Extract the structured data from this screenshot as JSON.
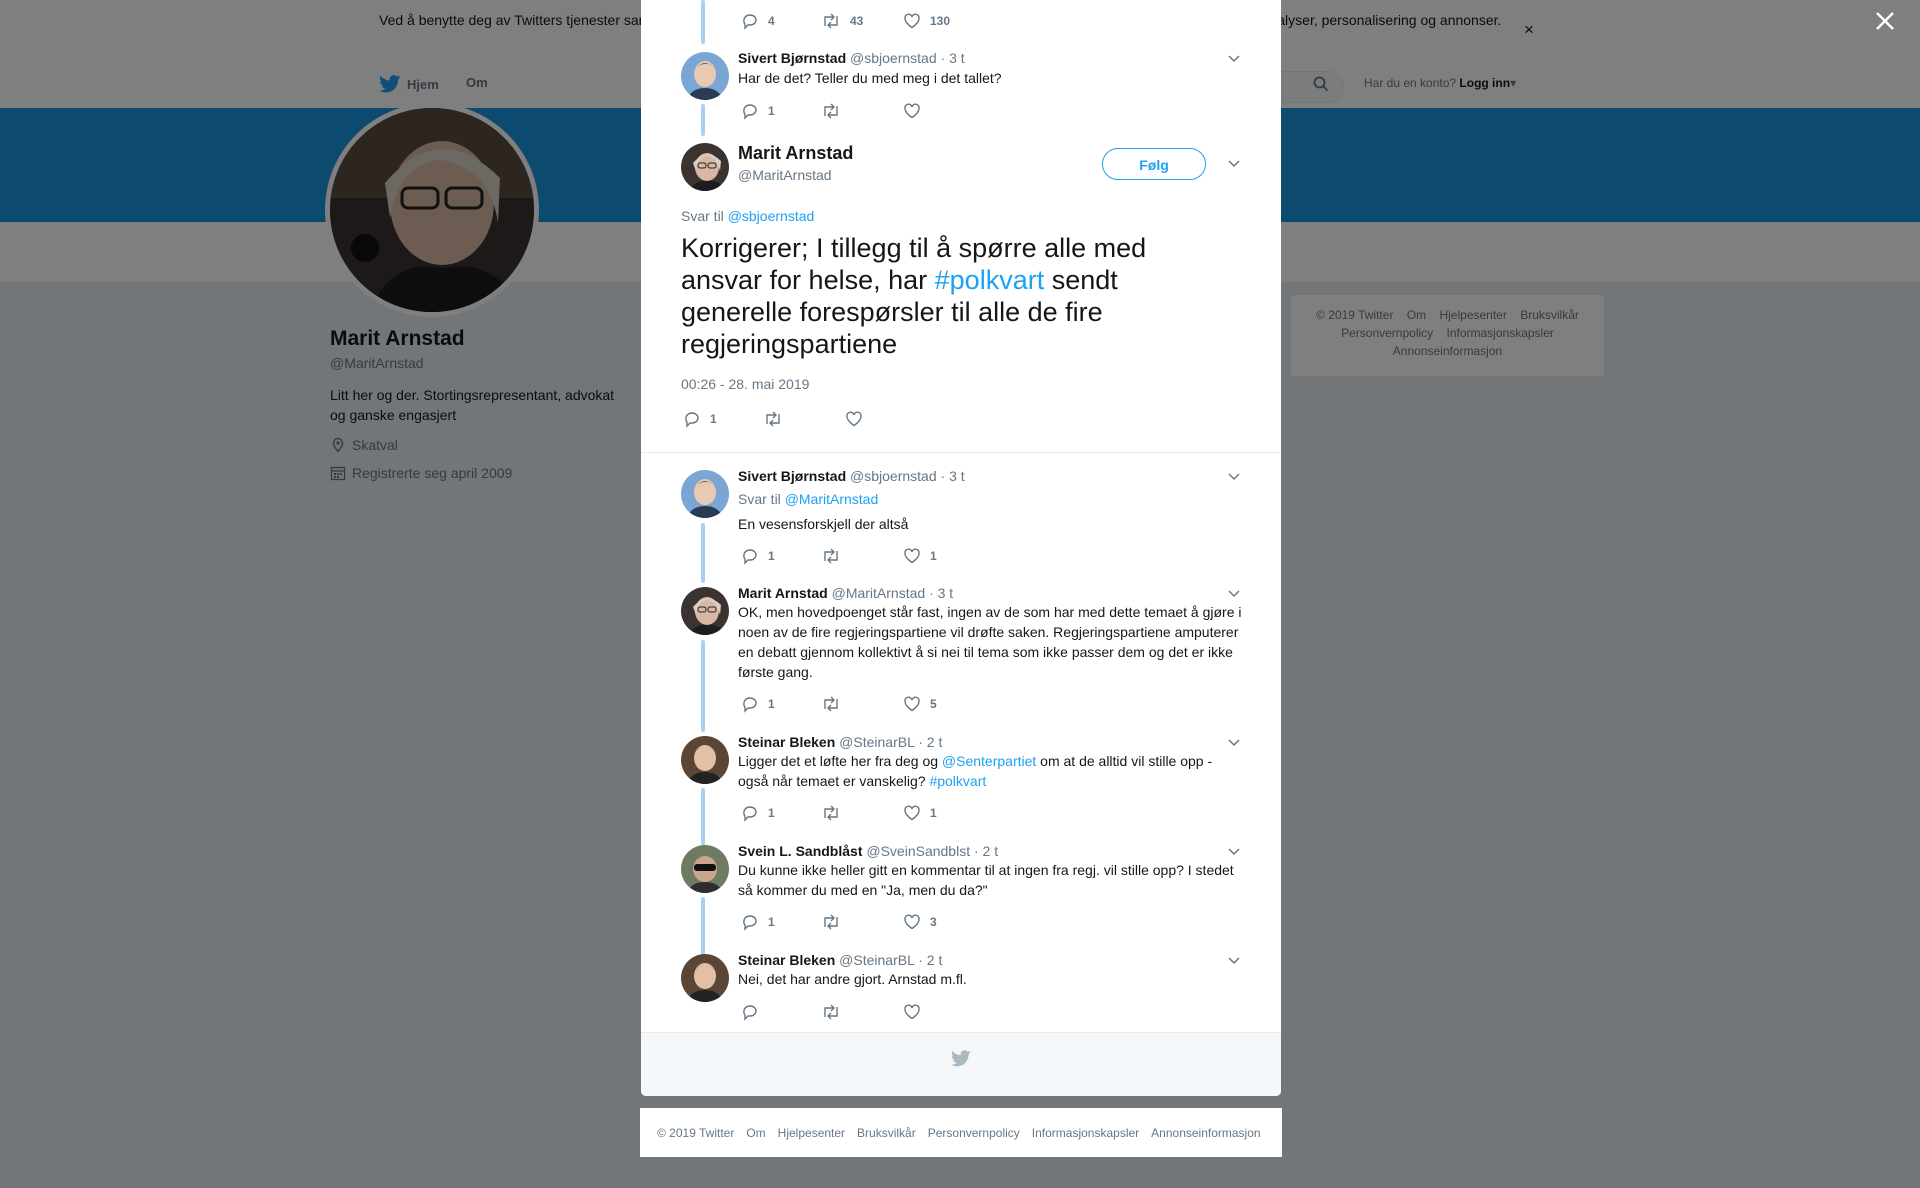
{
  "cookie": {
    "text": "Ved å benytte deg av Twitters tjenester samtykker du i vår bruk av informasjonskapsler. Vi og våre partnere bruker informasjonskapsler til bl.a. analyser, personalisering og annonser."
  },
  "nav": {
    "home": "Hjem",
    "about": "Om",
    "login_prompt": "Har du en konto?",
    "login_link": "Logg inn"
  },
  "profile": {
    "name": "Marit Arnstad",
    "handle": "@MaritArnstad",
    "bio": "Litt her og der. Stortingsrepresentant, advokat og ganske engasjert",
    "location": "Skatval",
    "joined": "Registrerte seg april 2009"
  },
  "side_footer": {
    "line1": [
      "© 2019 Twitter",
      "Om",
      "Hjelpesenter",
      "Bruksvilkår"
    ],
    "line2": [
      "Personvernpolicy",
      "Informasjonskapsler"
    ],
    "line3": [
      "Annonseinformasjon"
    ]
  },
  "top_stats": {
    "replies": "4",
    "retweets": "43",
    "likes": "130"
  },
  "tweet1": {
    "name": "Sivert Bjørnstad",
    "handle": "@sbjoernstad",
    "time": "· 3 t",
    "text": "Har de det? Teller du med meg i det tallet?",
    "replies": "1",
    "retweets": "",
    "likes": ""
  },
  "focus": {
    "name": "Marit Arnstad",
    "handle": "@MaritArnstad",
    "follow": "Følg",
    "reply_prefix": "Svar til",
    "reply_to": "@sbjoernstad",
    "text_a": "Korrigerer; I tillegg til å spørre alle med ansvar for helse, har ",
    "hashtag": "#polkvart",
    "text_b": " sendt generelle forespørsler til alle de fire regjeringspartiene",
    "timestamp": "00:26 - 28. mai 2019",
    "replies": "1"
  },
  "tweet2": {
    "name": "Sivert Bjørnstad",
    "handle": "@sbjoernstad",
    "time": "· 3 t",
    "reply_prefix": "Svar til",
    "reply_to": "@MaritArnstad",
    "text": "En vesensforskjell der altså",
    "replies": "1",
    "likes": "1"
  },
  "tweet3": {
    "name": "Marit Arnstad",
    "handle": "@MaritArnstad",
    "time": "· 3 t",
    "text": "OK, men hovedpoenget står fast, ingen av de som har med dette temaet å gjøre i noen av de fire regjeringspartiene vil drøfte saken.  Regjeringspartiene amputerer en debatt gjennom kollektivt å si nei til tema som ikke passer dem og det er ikke første gang.",
    "replies": "1",
    "likes": "5"
  },
  "tweet4": {
    "name": "Steinar Bleken",
    "handle": "@SteinarBL",
    "time": "· 2 t",
    "text_a": "Ligger det et løfte her fra deg og ",
    "mention": "@Senterpartiet",
    "text_b": " om at de alltid vil stille opp - også når temaet er vanskelig? ",
    "hashtag": "#polkvart",
    "replies": "1",
    "likes": "1"
  },
  "tweet5": {
    "name": "Svein L. Sandblåst",
    "handle": "@SveinSandblst",
    "time": "· 2 t",
    "text": "Du kunne ikke heller gitt en kommentar til at ingen fra regj. vil stille opp? I stedet så kommer du med en \"Ja, men du da?\"",
    "replies": "1",
    "likes": "3"
  },
  "tweet6": {
    "name": "Steinar Bleken",
    "handle": "@SteinarBL",
    "time": "· 2 t",
    "text": "Nei, det har andre gjort. Arnstad m.fl."
  },
  "bottom_footer": [
    "© 2019 Twitter",
    "Om",
    "Hjelpesenter",
    "Bruksvilkår",
    "Personvernpolicy",
    "Informasjonskapsler",
    "Annonseinformasjon"
  ],
  "colors": {
    "accent": "#1da1f2",
    "banner": "#1b95e0",
    "thread_line": "#a9d0f0"
  }
}
